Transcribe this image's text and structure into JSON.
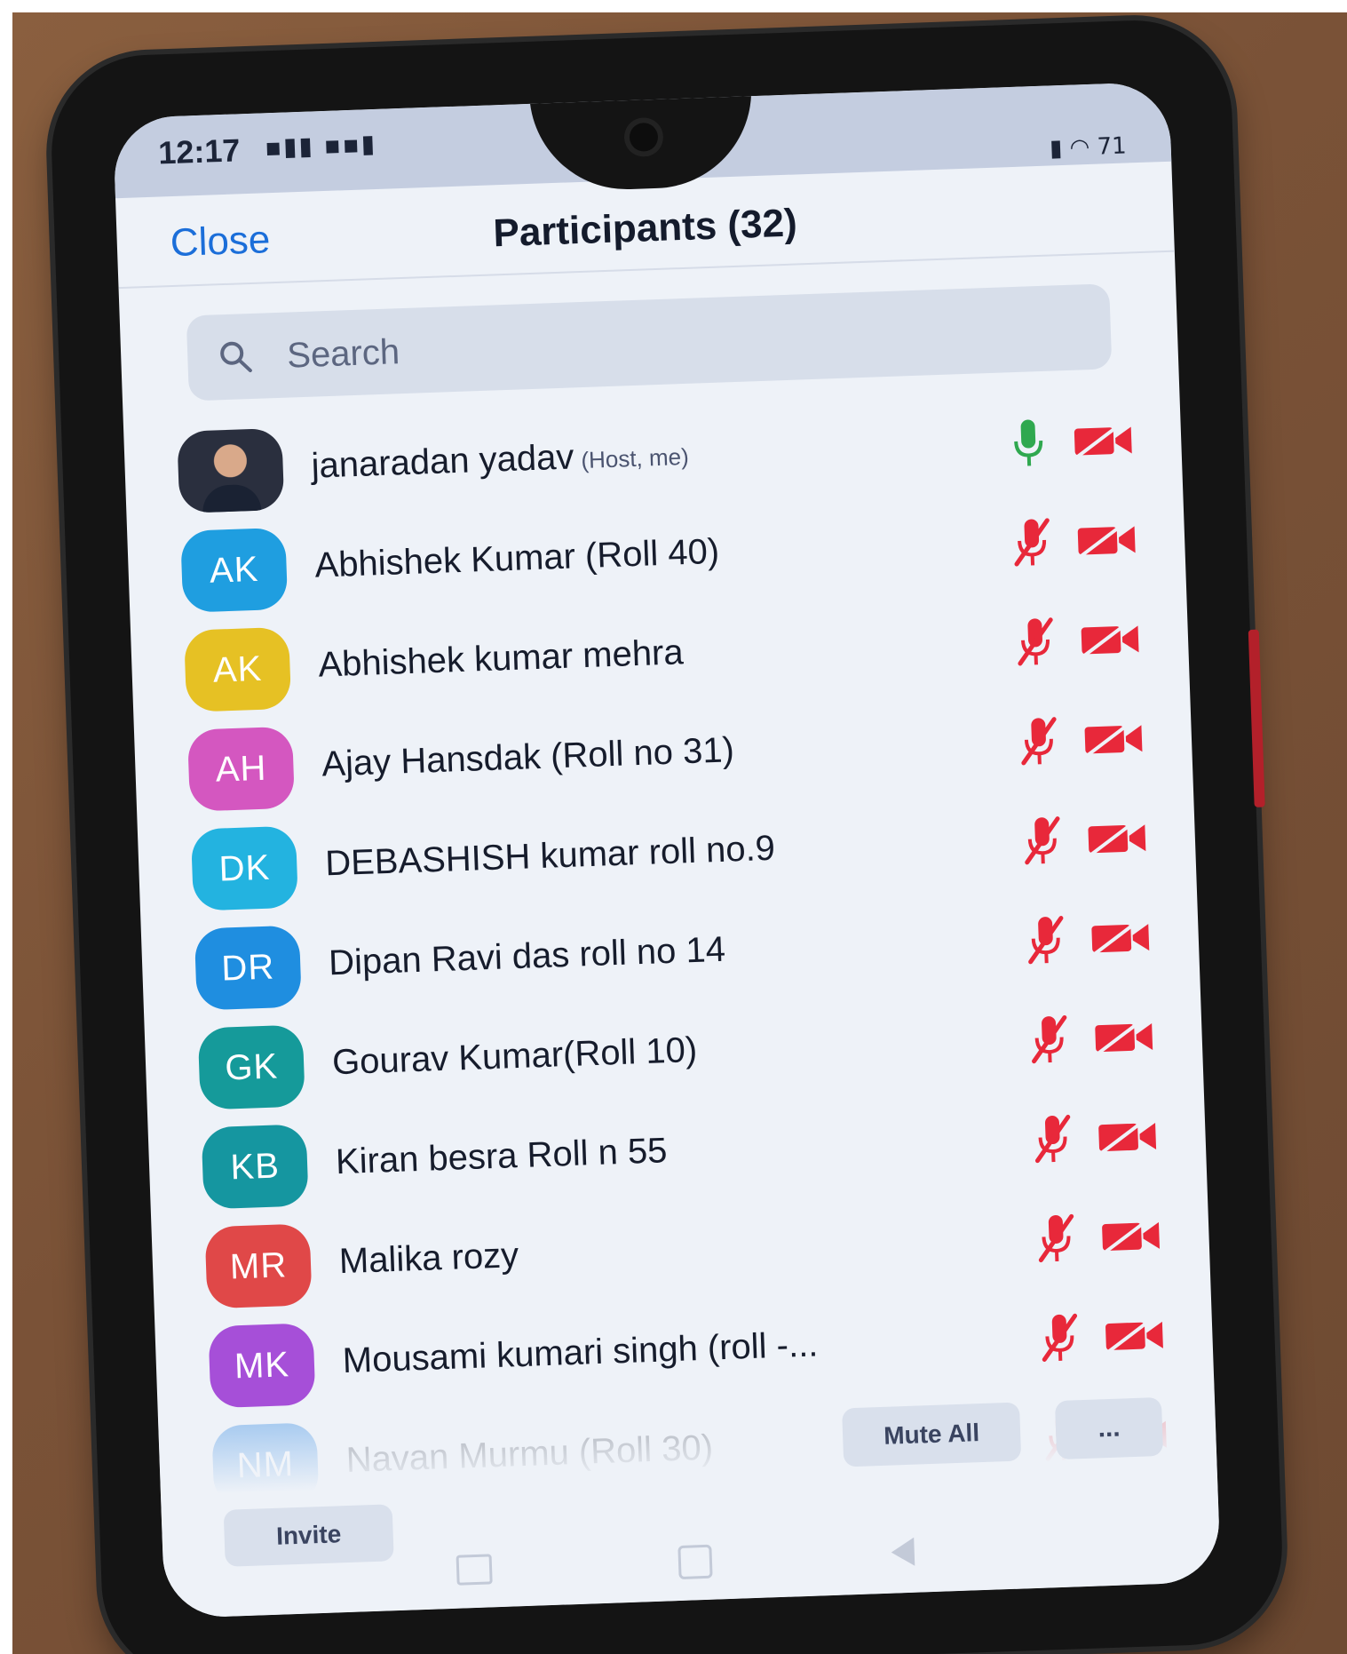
{
  "status_bar": {
    "time": "12:17",
    "signal_glyphs": "▪▮▮ ▪▪▮",
    "right_glyphs": "▮ ◠ 71"
  },
  "header": {
    "close_label": "Close",
    "title": "Participants (32)"
  },
  "search": {
    "placeholder": "Search"
  },
  "participants": [
    {
      "initials": "",
      "name": "janaradan yadav",
      "tag": "(Host, me)",
      "avatar_color": "",
      "has_photo": true,
      "mic": "on",
      "video": "off"
    },
    {
      "initials": "AK",
      "name": "Abhishek Kumar (Roll 40)",
      "tag": "",
      "avatar_color": "#1f9ee0",
      "mic": "muted",
      "video": "off"
    },
    {
      "initials": "AK",
      "name": "Abhishek kumar mehra",
      "tag": "",
      "avatar_color": "#e6c124",
      "mic": "muted",
      "video": "off"
    },
    {
      "initials": "AH",
      "name": "Ajay Hansdak (Roll no 31)",
      "tag": "",
      "avatar_color": "#d457c0",
      "mic": "muted",
      "video": "off"
    },
    {
      "initials": "DK",
      "name": "DEBASHISH kumar roll no.9",
      "tag": "",
      "avatar_color": "#23b3e0",
      "mic": "muted",
      "video": "off"
    },
    {
      "initials": "DR",
      "name": "Dipan Ravi das roll no 14",
      "tag": "",
      "avatar_color": "#1f8ee0",
      "mic": "muted",
      "video": "off"
    },
    {
      "initials": "GK",
      "name": "Gourav Kumar(Roll 10)",
      "tag": "",
      "avatar_color": "#159a9a",
      "mic": "muted",
      "video": "off"
    },
    {
      "initials": "KB",
      "name": "Kiran besra Roll n 55",
      "tag": "",
      "avatar_color": "#1596a0",
      "mic": "muted",
      "video": "off"
    },
    {
      "initials": "MR",
      "name": "Malika rozy",
      "tag": "",
      "avatar_color": "#e04848",
      "mic": "muted",
      "video": "off"
    },
    {
      "initials": "MK",
      "name": "Mousami kumari singh (roll -...",
      "tag": "",
      "avatar_color": "#a64fd8",
      "mic": "muted",
      "video": "off"
    },
    {
      "initials": "NM",
      "name": "Navan Murmu (Roll 30)",
      "tag": "",
      "avatar_color": "#1f7ee0",
      "mic": "muted",
      "video": "off"
    }
  ],
  "footer": {
    "mute_all_label": "Mute All",
    "more_label": "...",
    "invite_label": "Invite"
  },
  "colors": {
    "accent_blue": "#1b6ed9",
    "mic_on_green": "#2fa84f",
    "muted_red": "#e8283a"
  }
}
